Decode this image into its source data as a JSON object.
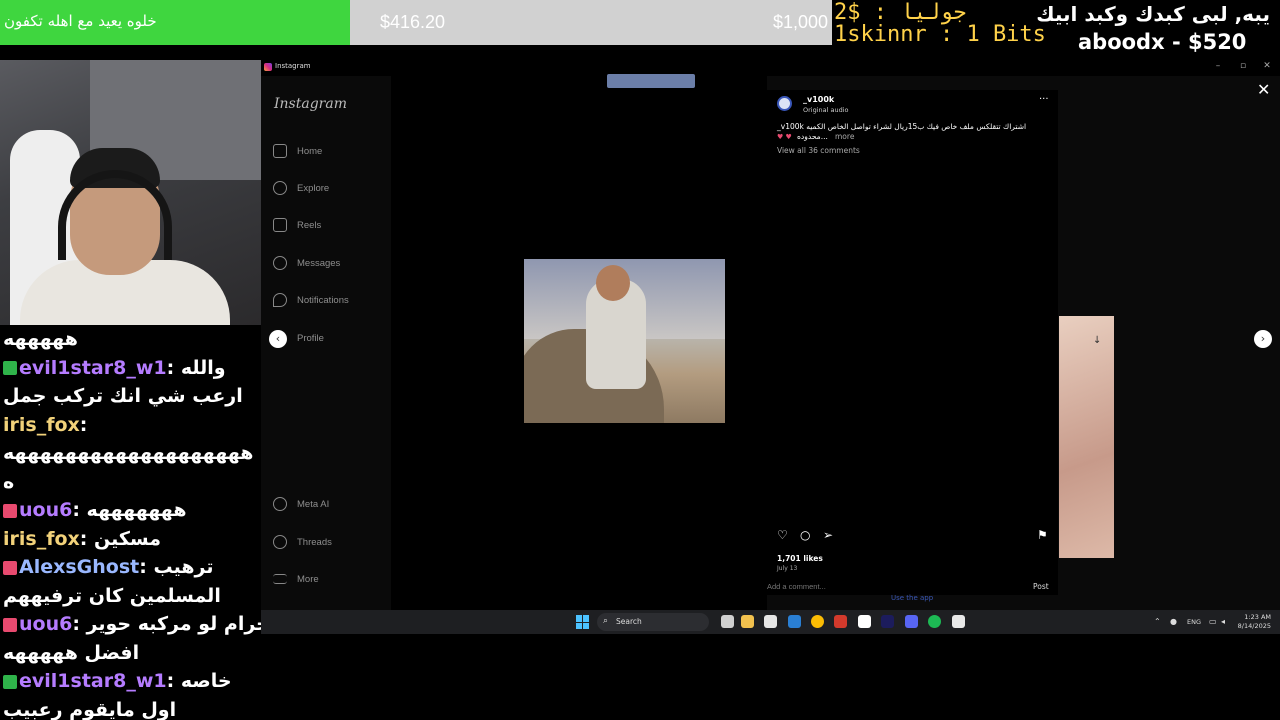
{
  "stream_overlay": {
    "alert_text": "خلوه يعيد مع اهله تكفون",
    "goal_current": "$416.20",
    "goal_target": "$1,000",
    "recent_tip_1": "2$ : جوليا",
    "recent_tip_2": "1skinnr : 1 Bits",
    "top_donor_line_1": "يبه, لبى كبدك وكبد ابيك",
    "top_donor_line_2": "aboodx - $520",
    "colors": {
      "alert_bg": "#3fd63f",
      "goal_bg": "#d1d1d1",
      "tip_text": "#ffd24a"
    }
  },
  "chat": {
    "messages": [
      {
        "user": "",
        "text": "هههههه",
        "badge": ""
      },
      {
        "user": "evil1star8_w1",
        "text": "والله",
        "badge": "green",
        "color": "purple"
      },
      {
        "user": "",
        "text": "ارعب شي انك تركب جمل",
        "badge": ""
      },
      {
        "user": "iris_fox",
        "text": "",
        "badge": "",
        "color": "yellow"
      },
      {
        "user": "",
        "text": "هههههههههههههههههههه",
        "badge": ""
      },
      {
        "user": "",
        "text": "ه",
        "badge": ""
      },
      {
        "user": "uou6",
        "text": "هههههههه",
        "badge": "heart",
        "color": "purple"
      },
      {
        "user": "iris_fox",
        "text": "مسكين",
        "badge": "",
        "color": "yellow"
      },
      {
        "user": "AlexsGhost",
        "text": "ترهيب",
        "badge": "heart",
        "color": "blue"
      },
      {
        "user": "",
        "text": "المسلمين كان ترفيههم",
        "badge": ""
      },
      {
        "user": "uou6",
        "text": "حرام لو مركبه حوير",
        "badge": "heart",
        "color": "purple"
      },
      {
        "user": "",
        "text": "افضل هههههه",
        "badge": ""
      },
      {
        "user": "evil1star8_w1",
        "text": "خاصه",
        "badge": "green",
        "color": "purple"
      },
      {
        "user": "",
        "text": "اول مايقوم رعبيب",
        "badge": ""
      }
    ]
  },
  "window": {
    "tab_title": "Instagram",
    "controls": [
      "–",
      "▫",
      "✕"
    ]
  },
  "instagram": {
    "logo": "Instagram",
    "nav": [
      {
        "label": "Home",
        "icon": "home-icon"
      },
      {
        "label": "Explore",
        "icon": "search-icon"
      },
      {
        "label": "Reels",
        "icon": "reels-icon"
      },
      {
        "label": "Messages",
        "icon": "messenger-icon"
      },
      {
        "label": "Notifications",
        "icon": "heart-icon"
      },
      {
        "label": "Profile",
        "icon": "profile-icon"
      }
    ],
    "nav_bottom": [
      {
        "label": "Meta AI",
        "icon": "meta-ai-icon"
      },
      {
        "label": "Threads",
        "icon": "threads-icon"
      },
      {
        "label": "More",
        "icon": "menu-icon"
      }
    ],
    "post": {
      "username": "_v100k",
      "audio": "Original audio",
      "caption": "اشتراك تتقلكس ملف خاص فيك ب15ريال لشراء تواصل الخاص الكميه v100k_",
      "caption_tail": "محدوده...",
      "more_label": "more",
      "view_comments": "View all 36 comments",
      "likes": "1,701 likes",
      "date": "July 13",
      "comment_placeholder": "Add a comment...",
      "post_label": "Post",
      "use_app": "Use the app"
    }
  },
  "taskbar": {
    "search_label": "Search",
    "language": "ENG",
    "time": "1:23 AM",
    "date": "8/14/2025"
  }
}
